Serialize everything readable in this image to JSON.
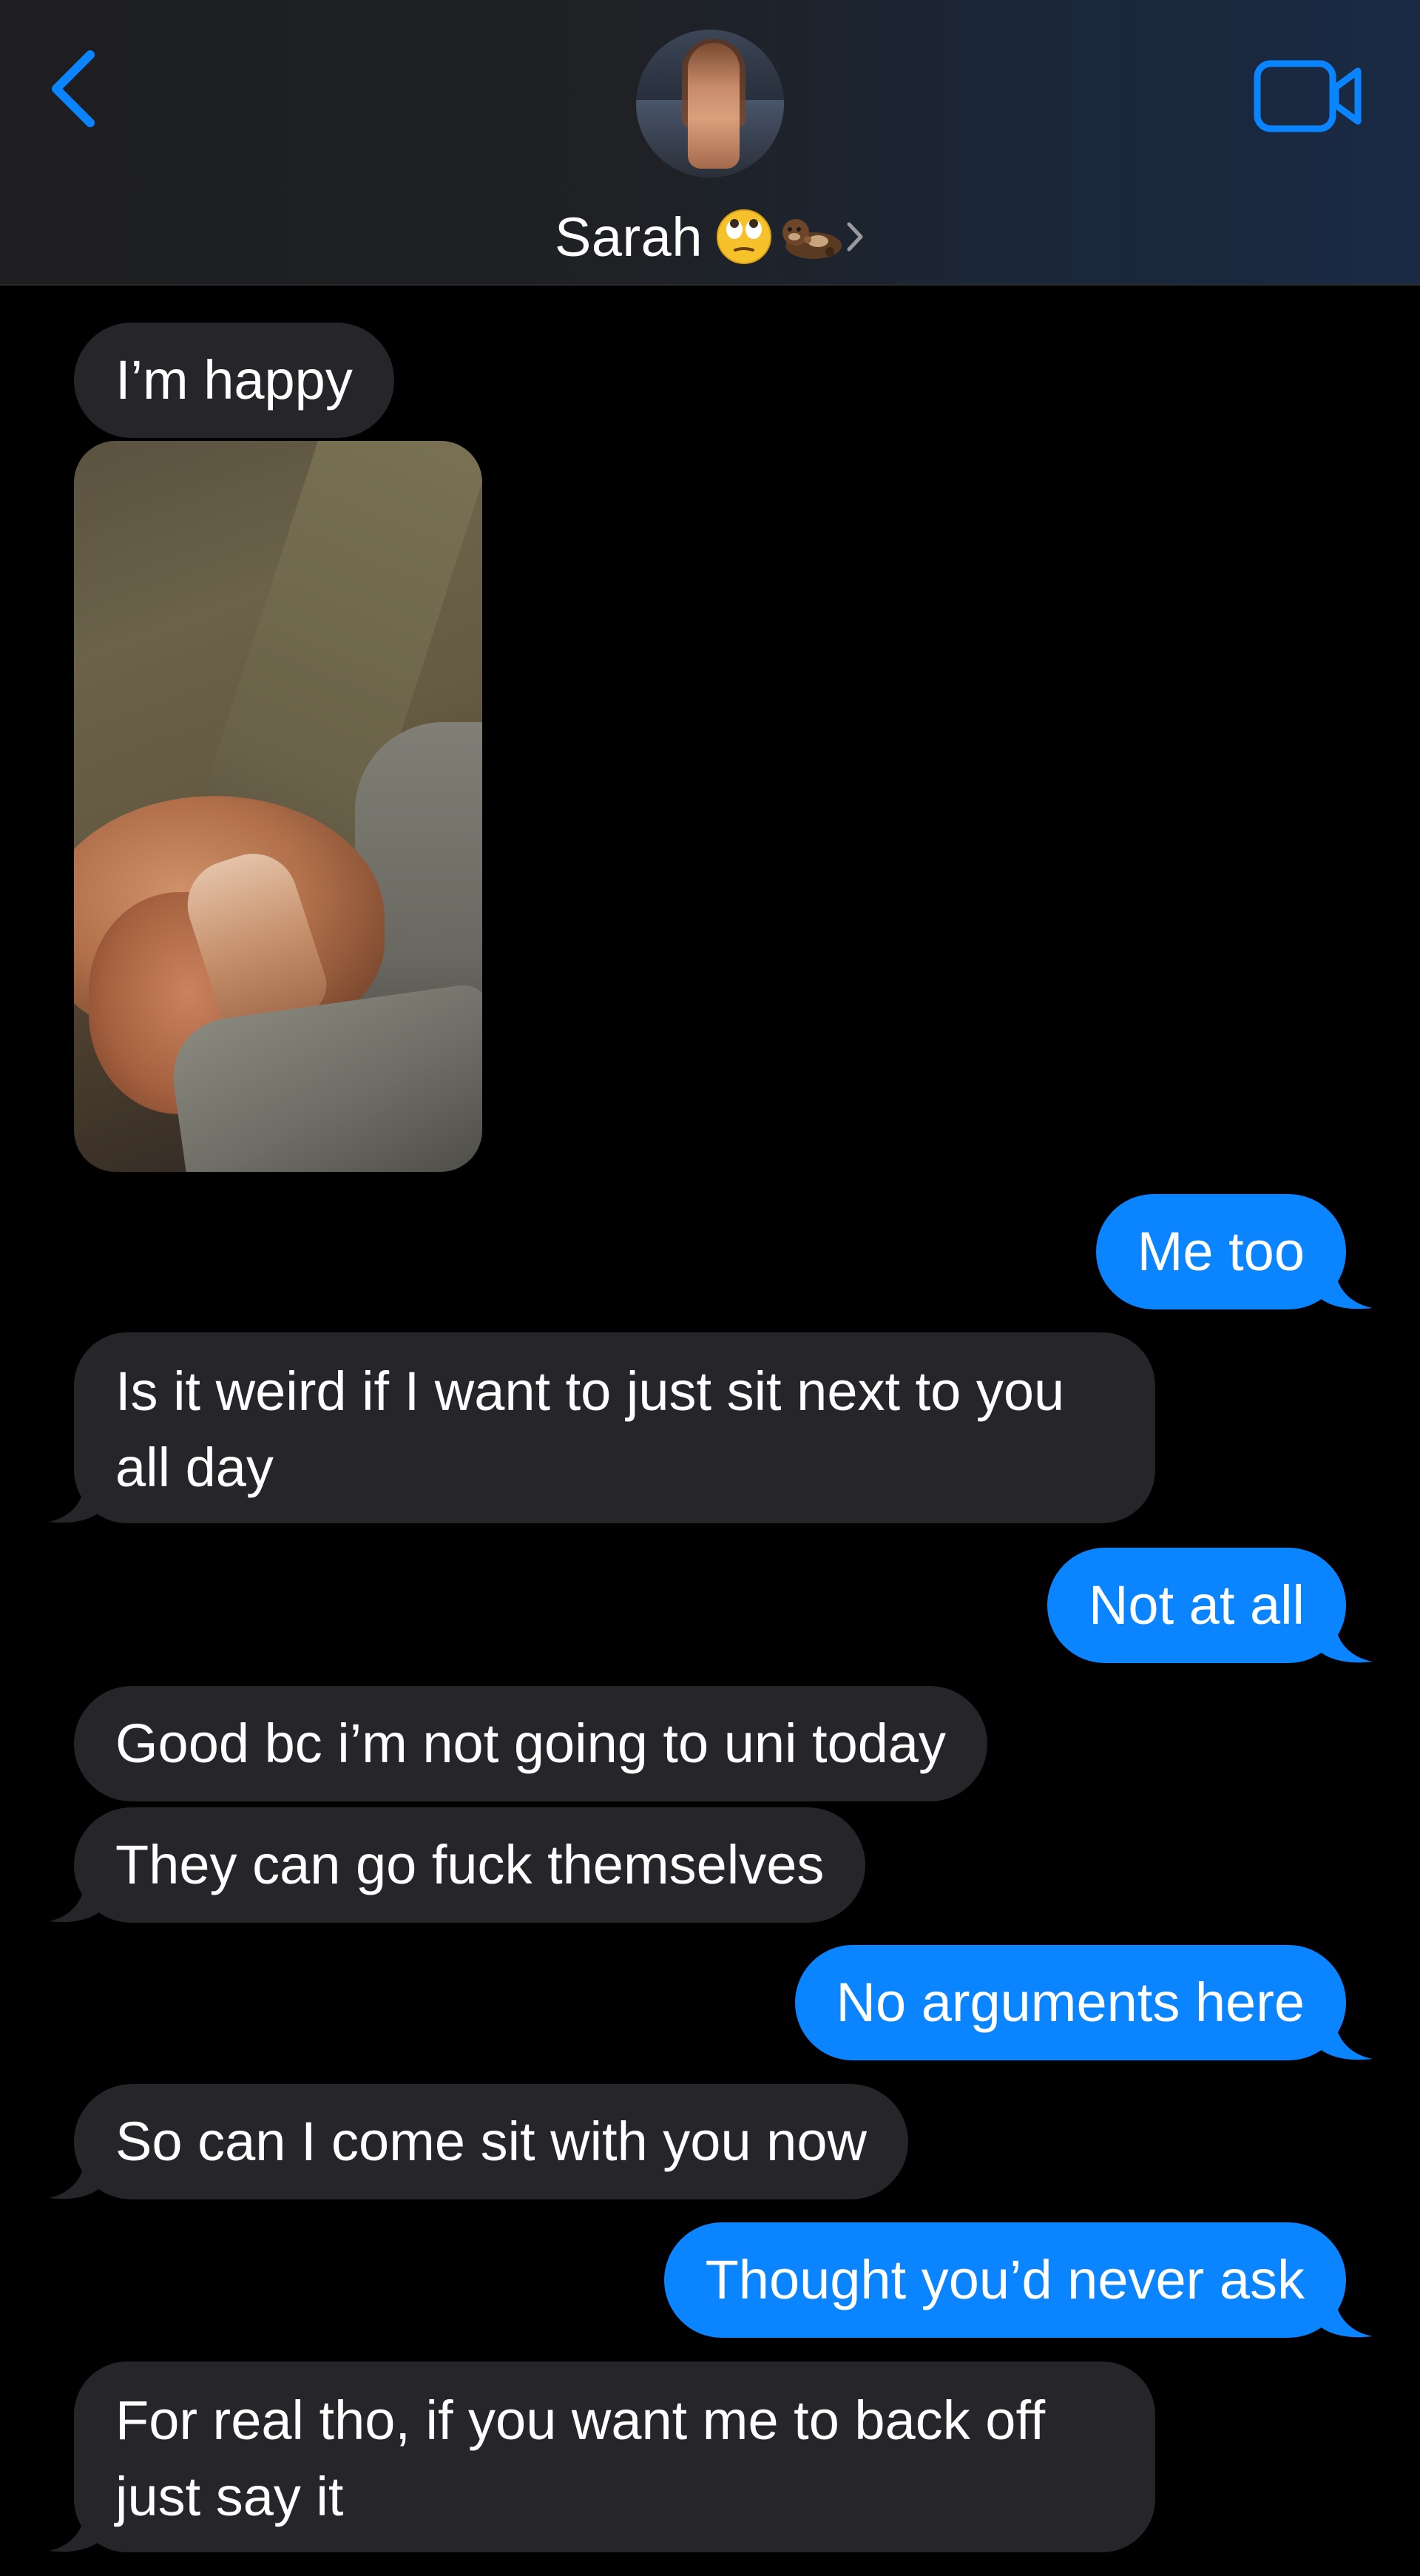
{
  "header": {
    "contact_name": "Sarah",
    "contact_emojis": [
      "face-with-rolling-eyes-emoji",
      "otter-emoji"
    ],
    "back_icon": "chevron-left-icon",
    "video_icon": "video-camera-icon",
    "accent_color": "#0a84ff"
  },
  "messages": [
    {
      "from": "them",
      "text": "I’m happy"
    },
    {
      "from": "them",
      "type": "photo"
    },
    {
      "from": "me",
      "text": "Me too"
    },
    {
      "from": "them",
      "text": "Is it weird if I want to just sit next to you all day"
    },
    {
      "from": "me",
      "text": "Not at all"
    },
    {
      "from": "them",
      "text": "Good bc i’m not going to uni today"
    },
    {
      "from": "them",
      "text": "They can go fuck themselves"
    },
    {
      "from": "me",
      "text": "No arguments here"
    },
    {
      "from": "them",
      "text": "So can I come sit with you now"
    },
    {
      "from": "me",
      "text": "Thought you’d never ask"
    },
    {
      "from": "them",
      "text": "For real tho, if you want me to back off just say it"
    }
  ],
  "colors": {
    "incoming_bubble": "#26252a",
    "outgoing_bubble": "#0a84ff",
    "background": "#000000"
  }
}
